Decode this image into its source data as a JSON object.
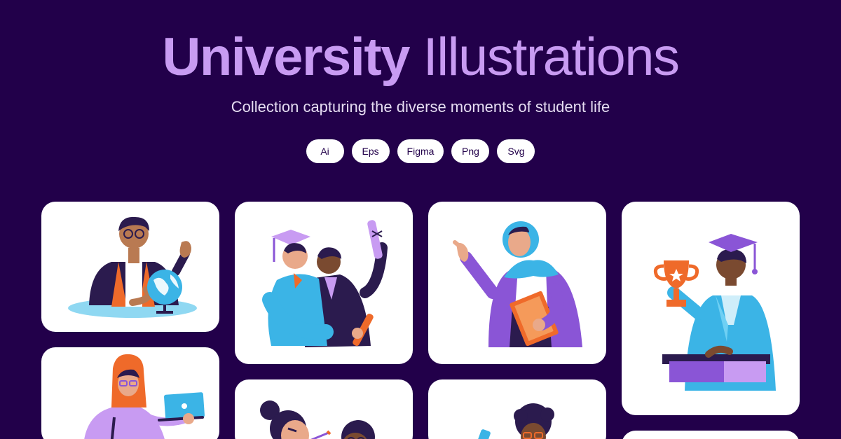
{
  "header": {
    "title_bold": "University",
    "title_light": "Illustrations",
    "subtitle": "Collection capturing the diverse moments of student life"
  },
  "formats": [
    "Ai",
    "Eps",
    "Figma",
    "Png",
    "Svg"
  ],
  "colors": {
    "background": "#22004a",
    "title": "#c89bf2",
    "card": "#ffffff",
    "purple": "#8a55d6",
    "orange": "#ef6a2a",
    "blue": "#3bb4e6",
    "navy": "#2b1b4e"
  },
  "illustrations": [
    "professor-with-globe",
    "graduates-celebrating",
    "teacher-in-hijab-with-book",
    "graduate-with-trophy",
    "student-with-laptop",
    "students-studying",
    "student-with-phone"
  ]
}
